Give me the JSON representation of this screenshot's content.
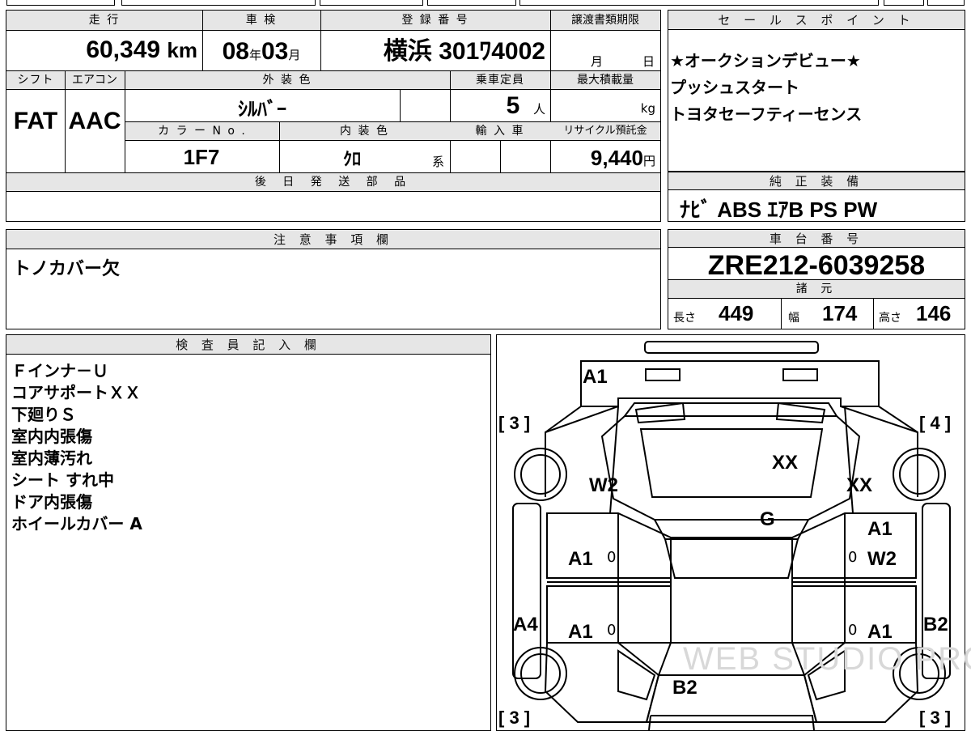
{
  "header": {
    "mileage_label": "走 行",
    "mileage_value": "60,349",
    "mileage_unit": "km",
    "shaken_label": "車 検",
    "shaken_year": "08",
    "shaken_year_unit": "年",
    "shaken_month": "03",
    "shaken_month_unit": "月",
    "registration_label": "登 録 番 号",
    "registration_value": "横浜 301ﾜ4002",
    "transfer_label": "譲渡書類期限",
    "transfer_month_unit": "月",
    "transfer_day_unit": "日"
  },
  "specs": {
    "shift_label": "シフト",
    "shift_value": "FAT",
    "aircon_label": "エアコン",
    "aircon_value": "AAC",
    "exterior_color_label": "外 装 色",
    "exterior_color_value": "ｼﾙﾊﾞｰ",
    "capacity_label": "乗車定員",
    "capacity_value": "5",
    "capacity_unit": "人",
    "max_load_label": "最大積載量",
    "max_load_unit": "kg",
    "color_no_label": "カ ラ ー N o .",
    "color_no_value": "1F7",
    "interior_color_label": "内 装 色",
    "interior_color_value": "ｸﾛ",
    "interior_color_suffix": "系",
    "import_label": "輸 入 車",
    "recycle_label": "リサイクル預託金",
    "recycle_value": "9,440",
    "recycle_unit": "円",
    "later_parts_label": "後 日 発 送 部 品"
  },
  "sales_points": {
    "label": "セ ー ル ス ポ イ ン ト",
    "lines": [
      "★オークションデビュー★",
      "プッシュスタート",
      "トヨタセーフティーセンス"
    ]
  },
  "equipment": {
    "label": "純 正 装 備",
    "value": "ﾅﾋﾞ ABS ｴｱB PS PW"
  },
  "notes": {
    "label": "注 意 事 項 欄",
    "value": "トノカバー欠"
  },
  "chassis": {
    "label": "車 台 番 号",
    "value": "ZRE212-6039258",
    "dims_label": "諸 元",
    "length_label": "長さ",
    "length_value": "449",
    "width_label": "幅",
    "width_value": "174",
    "height_label": "高さ",
    "height_value": "146"
  },
  "inspector": {
    "label": "検 査 員 記 入 欄",
    "lines": [
      "Ｆインナ－Ｕ",
      "コアサポートＸＸ",
      "下廻りＳ",
      "室内内張傷",
      "室内薄汚れ",
      "シート すれ中",
      "ドア内張傷",
      "ホイールカバー A"
    ]
  },
  "diagram": {
    "marks": {
      "front_bumper": "A1",
      "hood": "XX",
      "left_front_fender": "W2",
      "right_front_fender": "XX",
      "windshield": "G",
      "right_front_door_1": "A1",
      "right_front_door_2": "W2",
      "left_front_door": "A1",
      "left_rear_door": "A1",
      "right_rear_door": "A1",
      "left_rocker": "A4",
      "right_rear_fender": "B2",
      "rear_trunk": "B2",
      "door_zero_1": "0",
      "door_zero_2": "0",
      "door_zero_3": "0",
      "door_zero_4": "0"
    },
    "tire_left_front": "[ 3 ]",
    "tire_right_front": "[ 4 ]",
    "tire_left_rear": "[ 3 ]",
    "tire_right_rear": "[ 3 ]",
    "watermark": "WEB STUDIO PRO"
  }
}
